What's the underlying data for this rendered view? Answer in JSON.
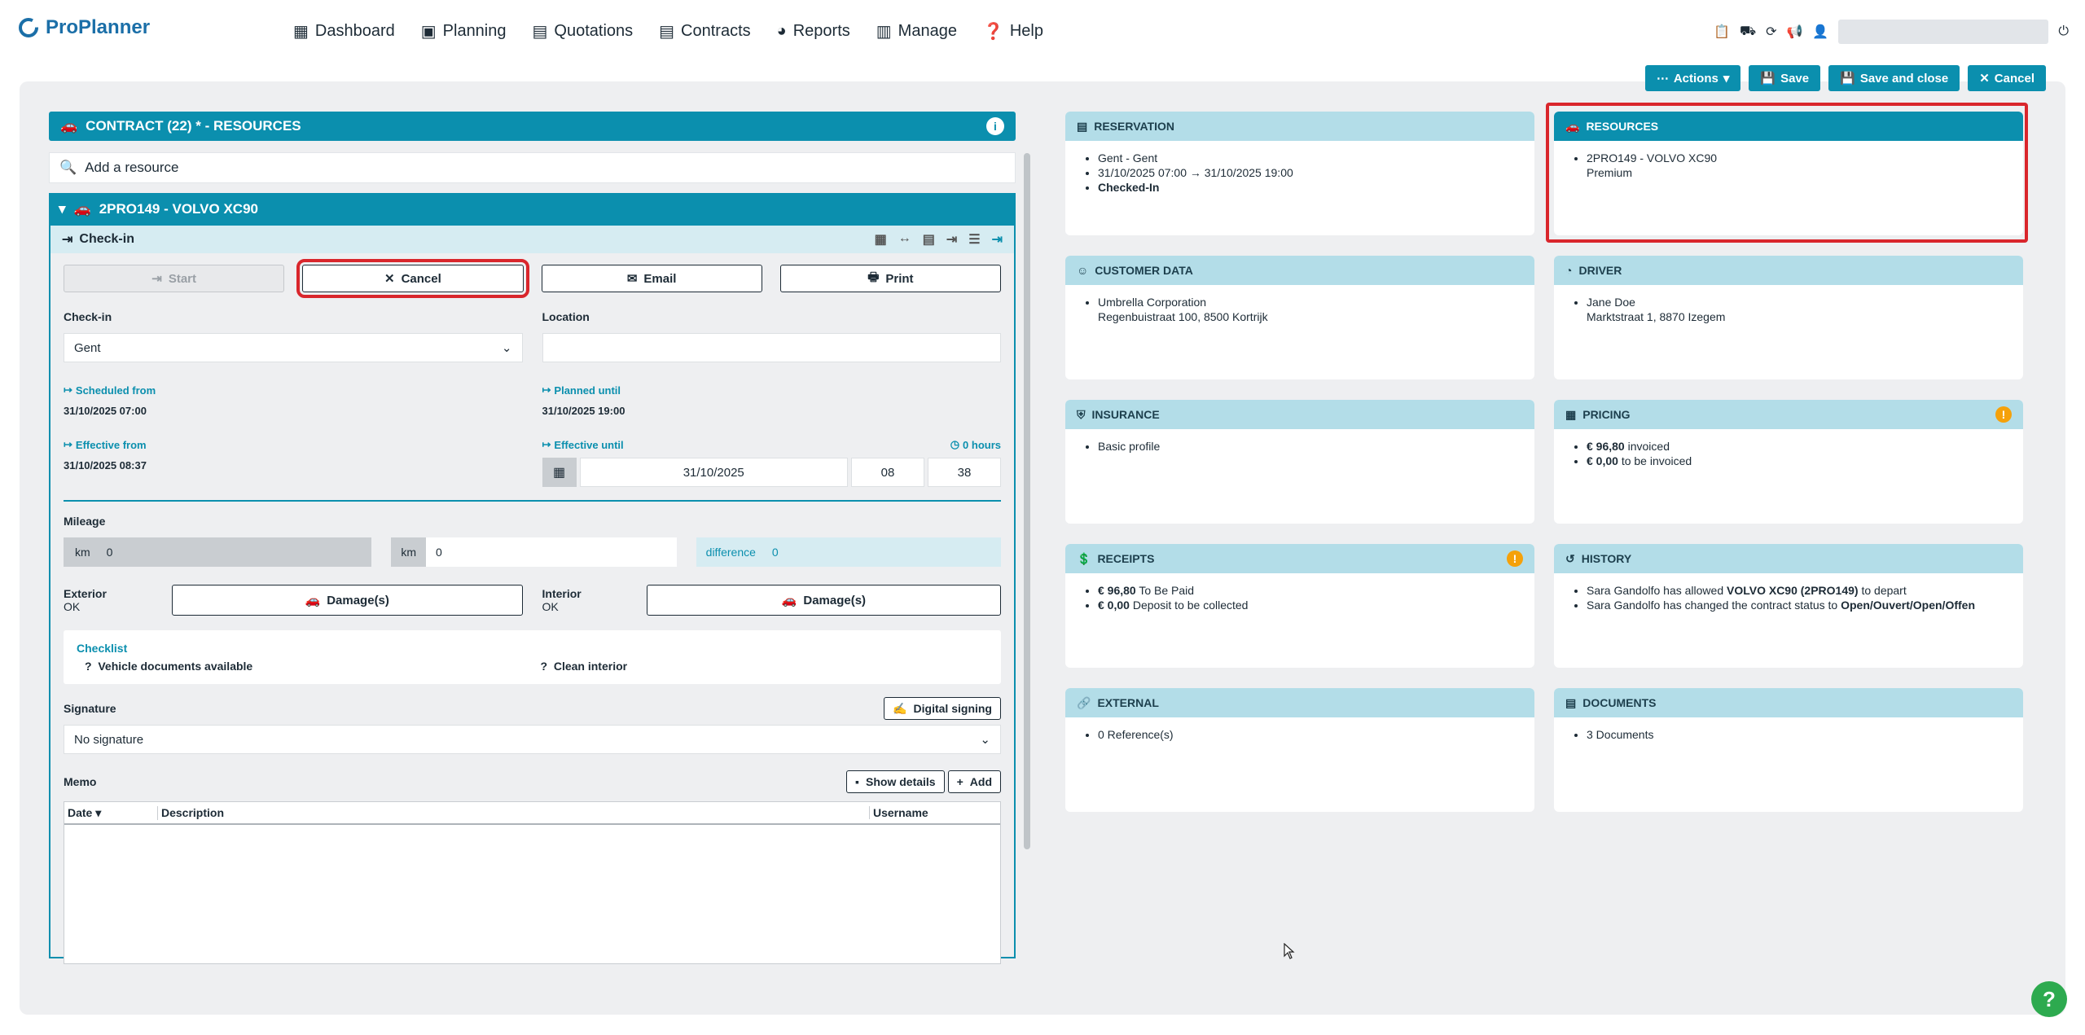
{
  "app": {
    "name": "ProPlanner",
    "colors": {
      "accent": "#0b8fae",
      "highlight": "#d9262c",
      "warning": "#f5a10a",
      "help": "#2daa4f"
    }
  },
  "menu": [
    {
      "label": "Dashboard",
      "icon": "dashboard-icon"
    },
    {
      "label": "Planning",
      "icon": "calendar-icon"
    },
    {
      "label": "Quotations",
      "icon": "document-icon"
    },
    {
      "label": "Contracts",
      "icon": "document-icon"
    },
    {
      "label": "Reports",
      "icon": "pie-chart-icon"
    },
    {
      "label": "Manage",
      "icon": "manage-icon"
    },
    {
      "label": "Help",
      "icon": "question-icon"
    }
  ],
  "toolbar": {
    "actions": "Actions",
    "save": "Save",
    "save_close": "Save and close",
    "cancel": "Cancel"
  },
  "contract": {
    "title": "CONTRACT (22) * - RESOURCES",
    "search_placeholder": "Add a resource",
    "resource_title": "2PRO149 - VOLVO XC90",
    "checkin_title": "Check-in"
  },
  "buttons": {
    "start": "Start",
    "cancel": "Cancel",
    "email": "Email",
    "print": "Print"
  },
  "checkin": {
    "label": "Check-in",
    "value": "Gent",
    "location_label": "Location",
    "location_value": "",
    "scheduled_from_label": "Scheduled from",
    "scheduled_from": "31/10/2025 07:00",
    "planned_until_label": "Planned until",
    "planned_until": "31/10/2025 19:00",
    "effective_from_label": "Effective from",
    "effective_from": "31/10/2025 08:37",
    "effective_until_label": "Effective until",
    "hours": "0 hours",
    "date": "31/10/2025",
    "hour": "08",
    "minute": "38"
  },
  "mileage": {
    "label": "Mileage",
    "unit1": "km",
    "value1": "0",
    "unit2": "km",
    "value2": "0",
    "diff_label": "difference",
    "diff_value": "0"
  },
  "damage": {
    "exterior_label": "Exterior",
    "exterior_value": "OK",
    "interior_label": "Interior",
    "interior_value": "OK",
    "button": "Damage(s)"
  },
  "checklist": {
    "title": "Checklist",
    "items": [
      "Vehicle documents available",
      "Clean interior"
    ]
  },
  "signature": {
    "label": "Signature",
    "digital": "Digital signing",
    "value": "No signature"
  },
  "memo": {
    "label": "Memo",
    "show_details": "Show details",
    "add": "Add",
    "columns": [
      "Date",
      "Description",
      "Username"
    ]
  },
  "cards": {
    "reservation": {
      "title": "RESERVATION",
      "lines": [
        "Gent - Gent",
        "31/10/2025 07:00 → 31/10/2025 19:00",
        "Checked-In"
      ]
    },
    "resources": {
      "title": "RESOURCES",
      "lines": [
        "2PRO149 - VOLVO XC90",
        "Premium"
      ]
    },
    "customer": {
      "title": "CUSTOMER DATA",
      "lines": [
        "Umbrella Corporation",
        "Regenbuistraat 100, 8500 Kortrijk"
      ]
    },
    "driver": {
      "title": "DRIVER",
      "lines": [
        "Jane Doe",
        "Marktstraat 1, 8870 Izegem"
      ]
    },
    "insurance": {
      "title": "INSURANCE",
      "lines": [
        "Basic profile"
      ]
    },
    "pricing": {
      "title": "PRICING",
      "l1a": "€ 96,80",
      "l1b": " invoiced",
      "l2a": "€ 0,00",
      "l2b": " to be invoiced"
    },
    "receipts": {
      "title": "RECEIPTS",
      "l1a": "€ 96,80",
      "l1b": " To Be Paid",
      "l2a": "€ 0,00",
      "l2b": " Deposit to be collected"
    },
    "history": {
      "title": "HISTORY",
      "h1a": "Sara Gandolfo has allowed ",
      "h1b": "VOLVO XC90 (2PRO149)",
      "h1c": " to depart",
      "h2a": "Sara Gandolfo has changed the contract status to ",
      "h2b": "Open/Ouvert/Open/Offen"
    },
    "external": {
      "title": "EXTERNAL",
      "lines": [
        "0 Reference(s)"
      ]
    },
    "documents": {
      "title": "DOCUMENTS",
      "lines": [
        "3 Documents"
      ]
    }
  }
}
